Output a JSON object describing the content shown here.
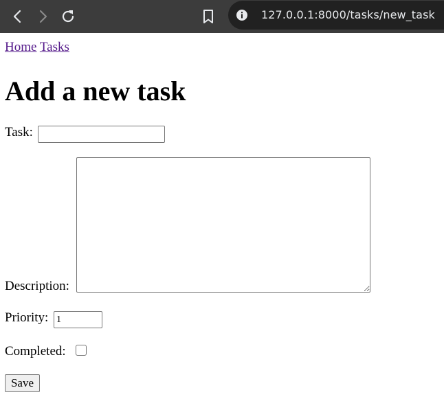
{
  "browser": {
    "url": "127.0.0.1:8000/tasks/new_task"
  },
  "nav": {
    "home_label": "Home",
    "tasks_label": "Tasks"
  },
  "page": {
    "title": "Add a new task"
  },
  "form": {
    "task_label": "Task:",
    "task_value": "",
    "description_label": "Description:",
    "description_value": "",
    "priority_label": "Priority:",
    "priority_value": "1",
    "completed_label": "Completed:",
    "completed_checked": false,
    "save_label": "Save"
  },
  "icons": {
    "back": "chevron-left-icon",
    "forward": "chevron-right-icon",
    "reload": "reload-icon",
    "bookmark": "bookmark-icon",
    "site_info": "info-icon"
  },
  "colors": {
    "toolbar": "#3c3c3c",
    "urlbar": "#212121",
    "visited_link": "#551a8b"
  }
}
